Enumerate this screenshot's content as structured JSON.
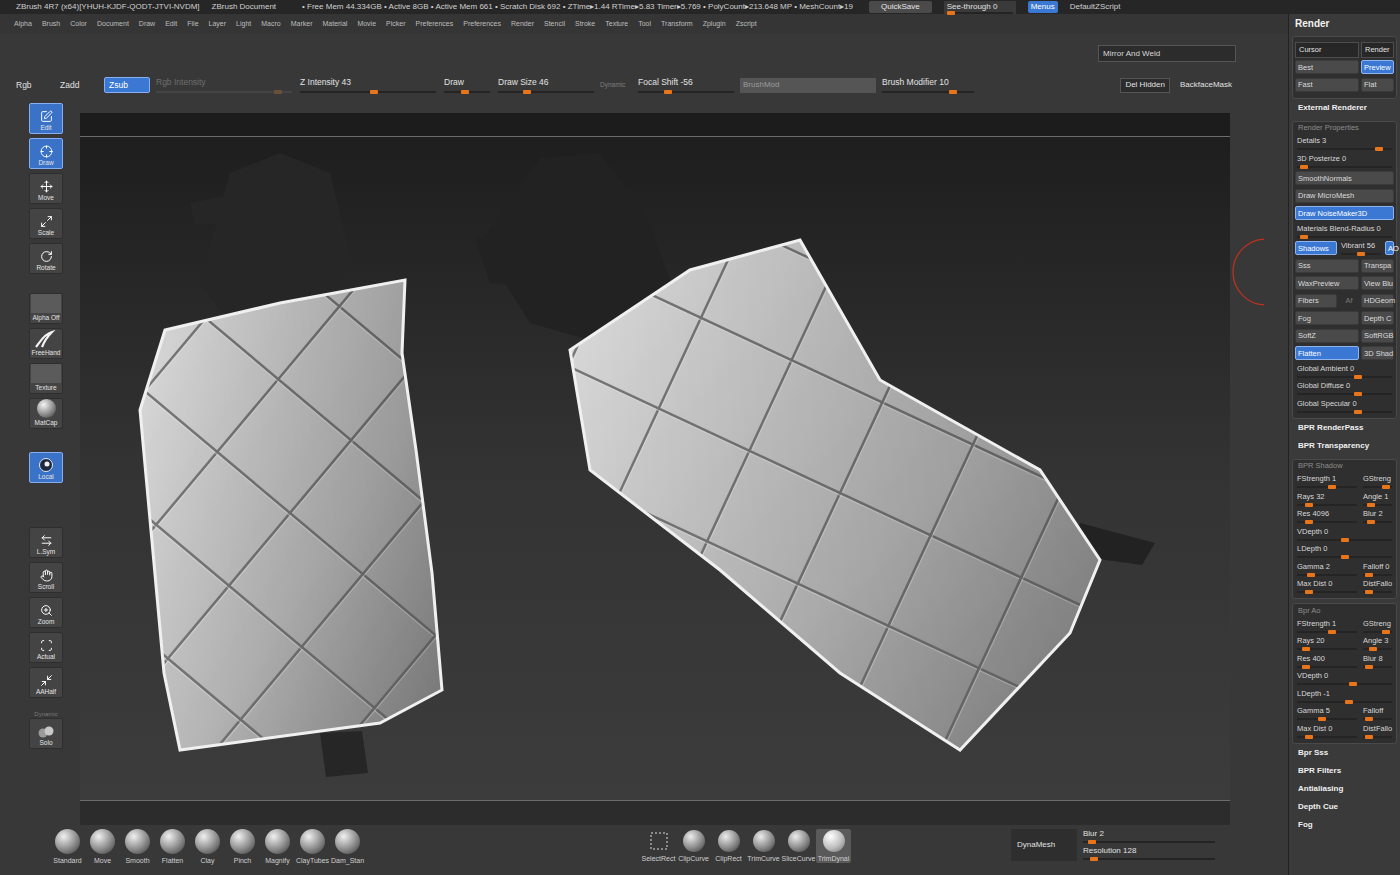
{
  "title_bar": {
    "app": "ZBrush 4R7 (x64)[YHUH-KJDF-QODT-JTVI-NVDM]",
    "document": "ZBrush Document",
    "stats": "• Free Mem 44.334GB • Active 8GB • Active Mem 661 • Scratch Disk 692 • ZTime▸1.44 RTime▸5.83 Timer▸5.769 • PolyCount▸213.648 MP • MeshCount▸19",
    "quicksave": "QuickSave",
    "see_through": {
      "label": "See-through  0",
      "level": 0
    },
    "menus": {
      "label": "Menus",
      "selected": true
    },
    "script": "DefaultZScript"
  },
  "menu_bar": [
    "Alpha",
    "Brush",
    "Color",
    "Document",
    "Draw",
    "Edit",
    "File",
    "Layer",
    "Light",
    "Macro",
    "Marker",
    "Material",
    "Movie",
    "Picker",
    "Preferences",
    "Preferences",
    "Render",
    "Stencil",
    "Stroke",
    "Texture",
    "Tool",
    "Transform",
    "Zplugin",
    "Zscript"
  ],
  "toolbar": {
    "mirror_and_weld": "Mirror And Weld",
    "items": [
      {
        "kind": "toggle",
        "label": "Rgb",
        "selected": false
      },
      {
        "kind": "toggle",
        "label": "Zadd",
        "selected": false
      },
      {
        "kind": "toggle",
        "label": "Zsub",
        "selected": true
      },
      {
        "kind": "slider",
        "label": "Rgb Intensity",
        "level": 0.92,
        "disabled": true
      },
      {
        "kind": "slider",
        "label": "Z Intensity 43",
        "level": 0.55,
        "disabled": false
      },
      {
        "kind": "slider",
        "label": "Draw",
        "level": 0.45,
        "disabled": false
      },
      {
        "kind": "slider",
        "label": "Draw Size 46",
        "level": 0.28,
        "disabled": false
      },
      {
        "kind": "caption",
        "label": "Dynamic"
      },
      {
        "kind": "slider",
        "label": "Focal Shift -56",
        "level": 0.3,
        "disabled": false
      },
      {
        "kind": "field",
        "label": "BrushMod"
      },
      {
        "kind": "slider",
        "label": "Brush Modifier 10",
        "level": 0.8,
        "disabled": false
      }
    ],
    "right": [
      {
        "label": "Del Hidden",
        "kind": "button"
      },
      {
        "label": "BackfaceMask",
        "kind": "text"
      }
    ]
  },
  "shelf": [
    [
      {
        "kind": "tool",
        "label": "Edit",
        "selected": true
      },
      {
        "kind": "tool",
        "label": "Draw",
        "selected": true
      },
      {
        "kind": "tool",
        "label": "Move",
        "selected": false
      },
      {
        "kind": "tool",
        "label": "Scale",
        "selected": false
      },
      {
        "kind": "tool",
        "label": "Rotate",
        "selected": false
      }
    ],
    [
      {
        "kind": "swatch",
        "label": "Alpha Off",
        "selected": false
      },
      {
        "kind": "stroke",
        "label": "FreeHand",
        "selected": false
      },
      {
        "kind": "swatch",
        "label": "Texture",
        "selected": false
      },
      {
        "kind": "matcap",
        "label": "MatCap",
        "selected": false
      }
    ],
    [
      {
        "kind": "local",
        "label": "Local",
        "selected": true
      }
    ],
    [
      {
        "kind": "tool",
        "label": "L.Sym",
        "selected": false
      },
      {
        "kind": "tool",
        "label": "Scroll",
        "selected": false
      },
      {
        "kind": "tool",
        "label": "Zoom",
        "selected": false
      },
      {
        "kind": "tool",
        "label": "Actual",
        "selected": false
      },
      {
        "kind": "tool",
        "label": "AAHalf",
        "selected": false
      }
    ],
    [
      {
        "kind": "solo",
        "label": "Solo",
        "caption": "Dynamic",
        "selected": false
      }
    ]
  ],
  "bottom_bar": {
    "brushes": [
      "Standard",
      "Move",
      "Smooth",
      "Flatten",
      "Clay",
      "Pinch",
      "Magnify",
      "ClayTubes",
      "Dam_Stan"
    ],
    "clip_tools": [
      {
        "label": "SelectRect",
        "selected": false
      },
      {
        "label": "ClipCurve",
        "selected": false
      },
      {
        "label": "ClipRect",
        "selected": false
      },
      {
        "label": "TrimCurve",
        "selected": false
      },
      {
        "label": "SliceCurve",
        "selected": false
      },
      {
        "label": "TrimDynai",
        "selected": true
      }
    ],
    "dynamesh": {
      "label": "DynaMesh",
      "sliders": [
        {
          "label": "Blur 2",
          "level": 0.04
        },
        {
          "label": "Resolution 128",
          "level": 0.06
        }
      ]
    }
  },
  "render_panel": {
    "title": "Render",
    "blocks": [
      {
        "kind": "box",
        "rows": [
          [
            {
              "label": "Cursor",
              "kind": "button"
            },
            {
              "label": "Render",
              "kind": "button"
            }
          ],
          [
            {
              "label": "Best",
              "kind": "toggle",
              "selected": false
            },
            {
              "label": "Preview",
              "kind": "toggle",
              "selected": true
            }
          ],
          [
            {
              "label": "Fast",
              "kind": "toggle",
              "selected": false
            },
            {
              "label": "Flat",
              "kind": "toggle",
              "selected": false
            }
          ]
        ]
      },
      {
        "kind": "header",
        "label": "External Renderer"
      },
      {
        "kind": "section",
        "label": "Render Properties",
        "rows": [
          [
            {
              "label": "Details 3",
              "kind": "slider",
              "level": 0.9
            }
          ],
          [
            {
              "label": "3D Posterize 0",
              "kind": "slider",
              "level": 0.04
            }
          ],
          [
            {
              "label": "SmoothNormals",
              "kind": "toggle",
              "selected": false
            }
          ],
          [
            {
              "label": "Draw MicroMesh",
              "kind": "toggle",
              "selected": false
            }
          ],
          [
            {
              "label": "Draw NoiseMaker3D",
              "kind": "toggle",
              "selected": true
            }
          ],
          [
            {
              "label": "Materials Blend-Radius 0",
              "kind": "slider",
              "level": 0.04
            }
          ],
          [
            {
              "label": "Shadows",
              "kind": "toggle",
              "selected": true
            },
            {
              "label": "Vibrant 56",
              "kind": "slider",
              "level": 0.5
            },
            {
              "label": "AO",
              "kind": "toggle",
              "selected": true
            }
          ],
          [
            {
              "label": "Sss",
              "kind": "toggle",
              "selected": false
            },
            {
              "label": "Transpa",
              "kind": "toggle",
              "selected": false
            }
          ],
          [
            {
              "label": "WaxPreview",
              "kind": "toggle",
              "selected": false
            },
            {
              "label": "View Blu",
              "kind": "toggle",
              "selected": false
            }
          ],
          [
            {
              "label": "Fibers",
              "kind": "toggle",
              "selected": false
            },
            {
              "label": "Af",
              "kind": "text",
              "disabled": true
            },
            {
              "label": "HDGeom",
              "kind": "toggle",
              "selected": false
            }
          ],
          [
            {
              "label": "Fog",
              "kind": "toggle",
              "selected": false
            },
            {
              "label": "Depth C",
              "kind": "toggle",
              "selected": false
            }
          ],
          [
            {
              "label": "SoftZ",
              "kind": "toggle",
              "selected": false
            },
            {
              "label": "SoftRGB",
              "kind": "toggle",
              "selected": false
            }
          ],
          [
            {
              "label": "Flatten",
              "kind": "toggle",
              "selected": true
            },
            {
              "label": "3D Shad",
              "kind": "toggle",
              "selected": false
            }
          ],
          [
            {
              "label": "Global Ambient 0",
              "kind": "slider",
              "level": 0.65
            }
          ],
          [
            {
              "label": "Global Diffuse 0",
              "kind": "slider",
              "level": 0.65
            }
          ],
          [
            {
              "label": "Global Specular 0",
              "kind": "slider",
              "level": 0.65
            }
          ]
        ]
      },
      {
        "kind": "header",
        "label": "BPR RenderPass"
      },
      {
        "kind": "header",
        "label": "BPR Transparency"
      },
      {
        "kind": "section",
        "label": "BPR Shadow",
        "rows": [
          [
            {
              "label": "FStrength 1",
              "kind": "slider",
              "level": 0.6
            },
            {
              "label": "GStreng",
              "kind": "slider",
              "level": 0.9
            }
          ],
          [
            {
              "label": "Rays 32",
              "kind": "slider",
              "level": 0.15
            },
            {
              "label": "Angle 1",
              "kind": "slider",
              "level": 0.2
            }
          ],
          [
            {
              "label": "Res 4096",
              "kind": "slider",
              "level": 0.15
            },
            {
              "label": "Blur 2",
              "kind": "slider",
              "level": 0.2
            }
          ],
          [
            {
              "label": "VDepth 0",
              "kind": "slider",
              "level": 0.5
            }
          ],
          [
            {
              "label": "LDepth 0",
              "kind": "slider",
              "level": 0.5
            }
          ],
          [
            {
              "label": "Gamma 2",
              "kind": "slider",
              "level": 0.2
            },
            {
              "label": "Falloff 0",
              "kind": "slider",
              "level": 0.1
            }
          ],
          [
            {
              "label": "Max Dist 0",
              "kind": "slider",
              "level": 0.15
            },
            {
              "label": "DistFallo",
              "kind": "slider",
              "level": 0.1
            }
          ]
        ]
      },
      {
        "kind": "section",
        "label": "Bpr Ao",
        "rows": [
          [
            {
              "label": "FStrength 1",
              "kind": "slider",
              "level": 0.6
            },
            {
              "label": "GStreng",
              "kind": "slider",
              "level": 0.9
            }
          ],
          [
            {
              "label": "Rays 20",
              "kind": "slider",
              "level": 0.1
            },
            {
              "label": "Angle 3",
              "kind": "slider",
              "level": 0.3
            }
          ],
          [
            {
              "label": "Res 400",
              "kind": "slider",
              "level": 0.1
            },
            {
              "label": "Blur 8",
              "kind": "slider",
              "level": 0.1
            }
          ],
          [
            {
              "label": "VDepth 0",
              "kind": "slider",
              "level": 0.6
            }
          ],
          [
            {
              "label": "LDepth -1",
              "kind": "slider",
              "level": 0.55
            }
          ],
          [
            {
              "label": "Gamma 5",
              "kind": "slider",
              "level": 0.4
            },
            {
              "label": "Falloff",
              "kind": "slider",
              "level": 0.1
            }
          ],
          [
            {
              "label": "Max Dist 0",
              "kind": "slider",
              "level": 0.15
            },
            {
              "label": "DistFallo",
              "kind": "slider",
              "level": 0.1
            }
          ]
        ]
      },
      {
        "kind": "header",
        "label": "Bpr Sss"
      },
      {
        "kind": "header",
        "label": "BPR Filters"
      },
      {
        "kind": "header",
        "label": "Antialiasing"
      },
      {
        "kind": "header",
        "label": "Depth Cue"
      },
      {
        "kind": "header",
        "label": "Fog"
      }
    ]
  }
}
